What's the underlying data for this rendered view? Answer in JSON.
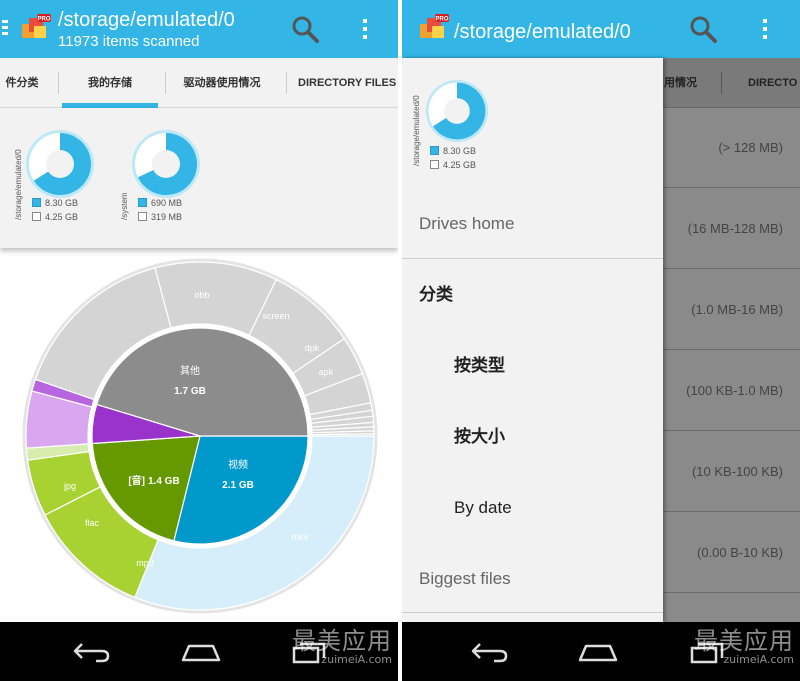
{
  "app": {
    "title": "/storage/emulated/0",
    "subtitle": "11973 items scanned"
  },
  "tabs": [
    "件分类",
    "我的存储",
    "驱动器使用情况",
    "DIRECTORY FILES"
  ],
  "right_tabs": [
    "用情况",
    "DIRECTO"
  ],
  "drives": [
    {
      "path": "/storage/emulated/0",
      "used": "8.30 GB",
      "free": "4.25 GB",
      "used_fraction": 0.66
    },
    {
      "path": "/system",
      "used": "690 MB",
      "free": "319 MB",
      "used_fraction": 0.68
    }
  ],
  "sunburst": {
    "center": [
      {
        "label": "其他",
        "value": "1.7 GB"
      },
      {
        "label": "视频",
        "value": "2.1 GB"
      },
      {
        "label": "[音]",
        "value": "1.4 GB"
      }
    ],
    "outer": [
      "obb",
      "screen",
      "dpk",
      "apk",
      "jpg",
      "flac",
      "mp3",
      "mkv"
    ],
    "colors": {
      "other": "#8c8c8c",
      "other_light": "#d4d4d4",
      "video": "#0099cc",
      "video_light": "#d5eef9",
      "audio": "#669900",
      "audio_light": "#a7d232",
      "image": "#9933cc",
      "image_light": "#d9a7f0"
    }
  },
  "drawer": {
    "drive": {
      "path": "/storage/emulated/0",
      "used": "8.30 GB",
      "free": "4.25 GB"
    },
    "items": {
      "home": "Drives home",
      "category": "分类",
      "by_type": "按类型",
      "by_size": "按大小",
      "by_date": "By date",
      "biggest": "Biggest files"
    }
  },
  "size_buckets": [
    "(> 128 MB)",
    "(16 MB-128 MB)",
    "(1.0 MB-16 MB)",
    "(100 KB-1.0 MB)",
    "(10 KB-100 KB)",
    "(0.00 B-10 KB)"
  ],
  "watermark": {
    "main": "最美应用",
    "sub": "zuimeiA.com"
  },
  "icons": {
    "menu": "hamburger-icon",
    "app": "app-icon",
    "search": "search-icon",
    "overflow": "overflow-menu-icon",
    "back": "back-icon",
    "home": "home-icon",
    "recents": "recents-icon"
  }
}
